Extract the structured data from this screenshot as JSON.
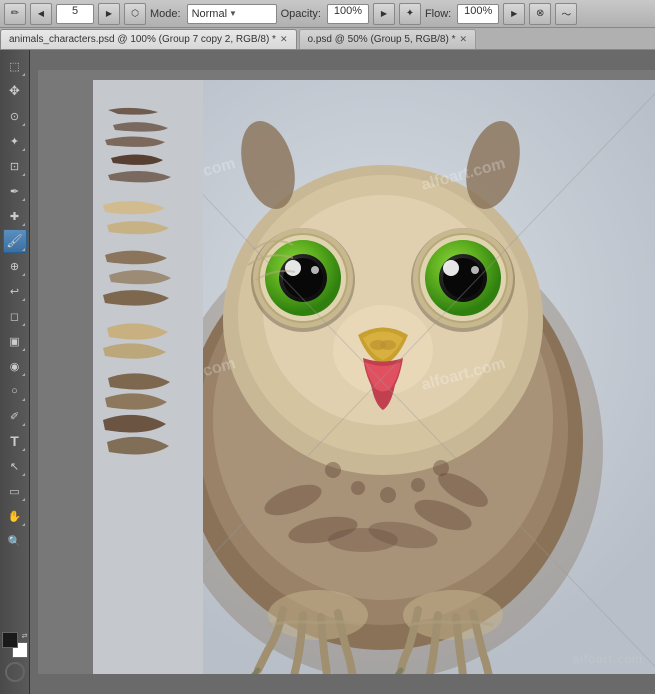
{
  "toolbar": {
    "brush_tool_label": "✏",
    "size_label": "5",
    "mode_label": "Mode:",
    "mode_value": "Normal",
    "opacity_label": "Opacity:",
    "opacity_value": "100%",
    "flow_label": "Flow:",
    "flow_value": "100%"
  },
  "tabs": [
    {
      "id": "tab1",
      "label": "animals_characters.psd @ 100% (Group 7 copy 2, RGB/8) *",
      "active": true
    },
    {
      "id": "tab2",
      "label": "o.psd @ 50% (Group 5, RGB/8) *",
      "active": false
    }
  ],
  "tools": [
    {
      "id": "marquee",
      "icon": "⬚",
      "active": false
    },
    {
      "id": "move",
      "icon": "✥",
      "active": false
    },
    {
      "id": "lasso",
      "icon": "⊙",
      "active": false
    },
    {
      "id": "magic-wand",
      "icon": "✦",
      "active": false
    },
    {
      "id": "crop",
      "icon": "⊞",
      "active": false
    },
    {
      "id": "eyedropper",
      "icon": "✒",
      "active": false
    },
    {
      "id": "healing",
      "icon": "✚",
      "active": false
    },
    {
      "id": "brush",
      "icon": "🖌",
      "active": true
    },
    {
      "id": "clone",
      "icon": "⊕",
      "active": false
    },
    {
      "id": "eraser",
      "icon": "◻",
      "active": false
    },
    {
      "id": "gradient",
      "icon": "▣",
      "active": false
    },
    {
      "id": "blur",
      "icon": "◉",
      "active": false
    },
    {
      "id": "dodge",
      "icon": "○",
      "active": false
    },
    {
      "id": "pen",
      "icon": "✐",
      "active": false
    },
    {
      "id": "type",
      "icon": "T",
      "active": false
    },
    {
      "id": "path-select",
      "icon": "↖",
      "active": false
    },
    {
      "id": "shape",
      "icon": "▭",
      "active": false
    },
    {
      "id": "hand",
      "icon": "✋",
      "active": false
    },
    {
      "id": "zoom",
      "icon": "🔍",
      "active": false
    }
  ],
  "canvas": {
    "zoom_percent": "100%",
    "layer_name": "Group 7 copy 2",
    "mode": "RGB/8"
  },
  "watermarks": [
    {
      "text": "alfoart.com",
      "position": "top-left"
    },
    {
      "text": "alfoart.com",
      "position": "top-right"
    },
    {
      "text": "alfoart.com",
      "position": "middle-left"
    },
    {
      "text": "alfoart.com",
      "position": "middle-right"
    },
    {
      "text": "alfoart.com",
      "position": "bottom-right"
    }
  ]
}
